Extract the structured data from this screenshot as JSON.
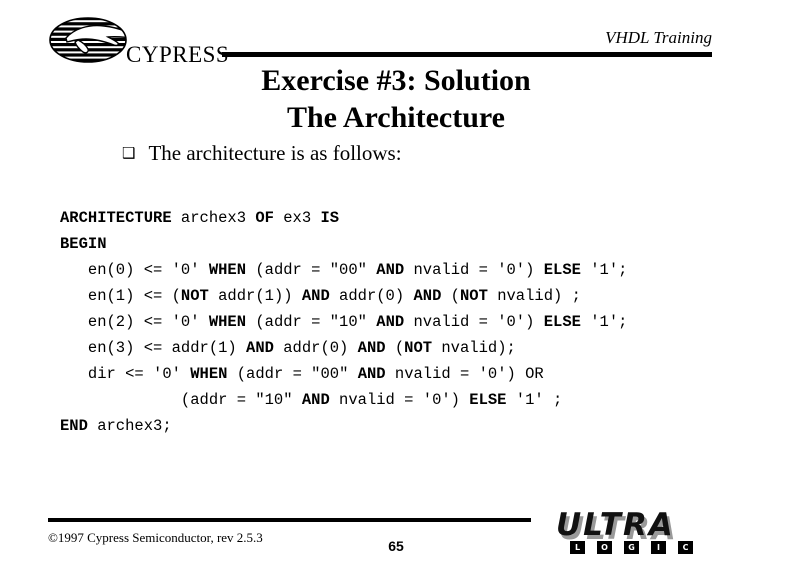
{
  "header": {
    "brand_name": "CYPRESS",
    "course_label": "VHDL Training",
    "logo_icon": "cypress-globe-logo"
  },
  "title": {
    "line1": "Exercise #3: Solution",
    "line2": "The Architecture"
  },
  "bullet": {
    "marker": "❑",
    "text": "The architecture is as follows:"
  },
  "code": {
    "language": "vhdl",
    "lines": [
      [
        {
          "t": "ARCHITECTURE",
          "b": true
        },
        {
          "t": " archex3 ",
          "b": false
        },
        {
          "t": "OF",
          "b": true
        },
        {
          "t": " ex3 ",
          "b": false
        },
        {
          "t": "IS",
          "b": true
        }
      ],
      [
        {
          "t": "BEGIN",
          "b": true
        }
      ],
      [
        {
          "t": "   en(0) <= '0' ",
          "b": false
        },
        {
          "t": "WHEN",
          "b": true
        },
        {
          "t": " (addr = \"00\" ",
          "b": false
        },
        {
          "t": "AND",
          "b": true
        },
        {
          "t": " nvalid = '0') ",
          "b": false
        },
        {
          "t": "ELSE",
          "b": true
        },
        {
          "t": " '1';",
          "b": false
        }
      ],
      [
        {
          "t": "   en(1) <= (",
          "b": false
        },
        {
          "t": "NOT",
          "b": true
        },
        {
          "t": " addr(1)) ",
          "b": false
        },
        {
          "t": "AND",
          "b": true
        },
        {
          "t": " addr(0) ",
          "b": false
        },
        {
          "t": "AND",
          "b": true
        },
        {
          "t": " (",
          "b": false
        },
        {
          "t": "NOT",
          "b": true
        },
        {
          "t": " nvalid) ;",
          "b": false
        }
      ],
      [
        {
          "t": "   en(2) <= '0' ",
          "b": false
        },
        {
          "t": "WHEN",
          "b": true
        },
        {
          "t": " (addr = \"10\" ",
          "b": false
        },
        {
          "t": "AND",
          "b": true
        },
        {
          "t": " nvalid = '0') ",
          "b": false
        },
        {
          "t": "ELSE",
          "b": true
        },
        {
          "t": " '1';",
          "b": false
        }
      ],
      [
        {
          "t": "   en(3) <= addr(1) ",
          "b": false
        },
        {
          "t": "AND",
          "b": true
        },
        {
          "t": " addr(0) ",
          "b": false
        },
        {
          "t": "AND",
          "b": true
        },
        {
          "t": " (",
          "b": false
        },
        {
          "t": "NOT",
          "b": true
        },
        {
          "t": " nvalid);",
          "b": false
        }
      ],
      [
        {
          "t": "   dir <= '0' ",
          "b": false
        },
        {
          "t": "WHEN",
          "b": true
        },
        {
          "t": " (addr = \"00\" ",
          "b": false
        },
        {
          "t": "AND",
          "b": true
        },
        {
          "t": " nvalid = '0') OR",
          "b": false
        }
      ],
      [
        {
          "t": "             (addr = \"10\" ",
          "b": false
        },
        {
          "t": "AND",
          "b": true
        },
        {
          "t": " nvalid = '0') ",
          "b": false
        },
        {
          "t": "ELSE",
          "b": true
        },
        {
          "t": " '1' ;",
          "b": false
        }
      ],
      [
        {
          "t": "END",
          "b": true
        },
        {
          "t": " archex3;",
          "b": false
        }
      ]
    ]
  },
  "footer": {
    "copyright": "©1997 Cypress Semiconductor, rev 2.5.3",
    "page_number": "65",
    "logo": {
      "wordmark": "ULTRA",
      "sub_letters": [
        "L",
        "O",
        "G",
        "I",
        "C"
      ]
    }
  },
  "colors": {
    "background": "#ffffff",
    "text": "#000000",
    "logo_shadow": "#8f8f8f"
  }
}
